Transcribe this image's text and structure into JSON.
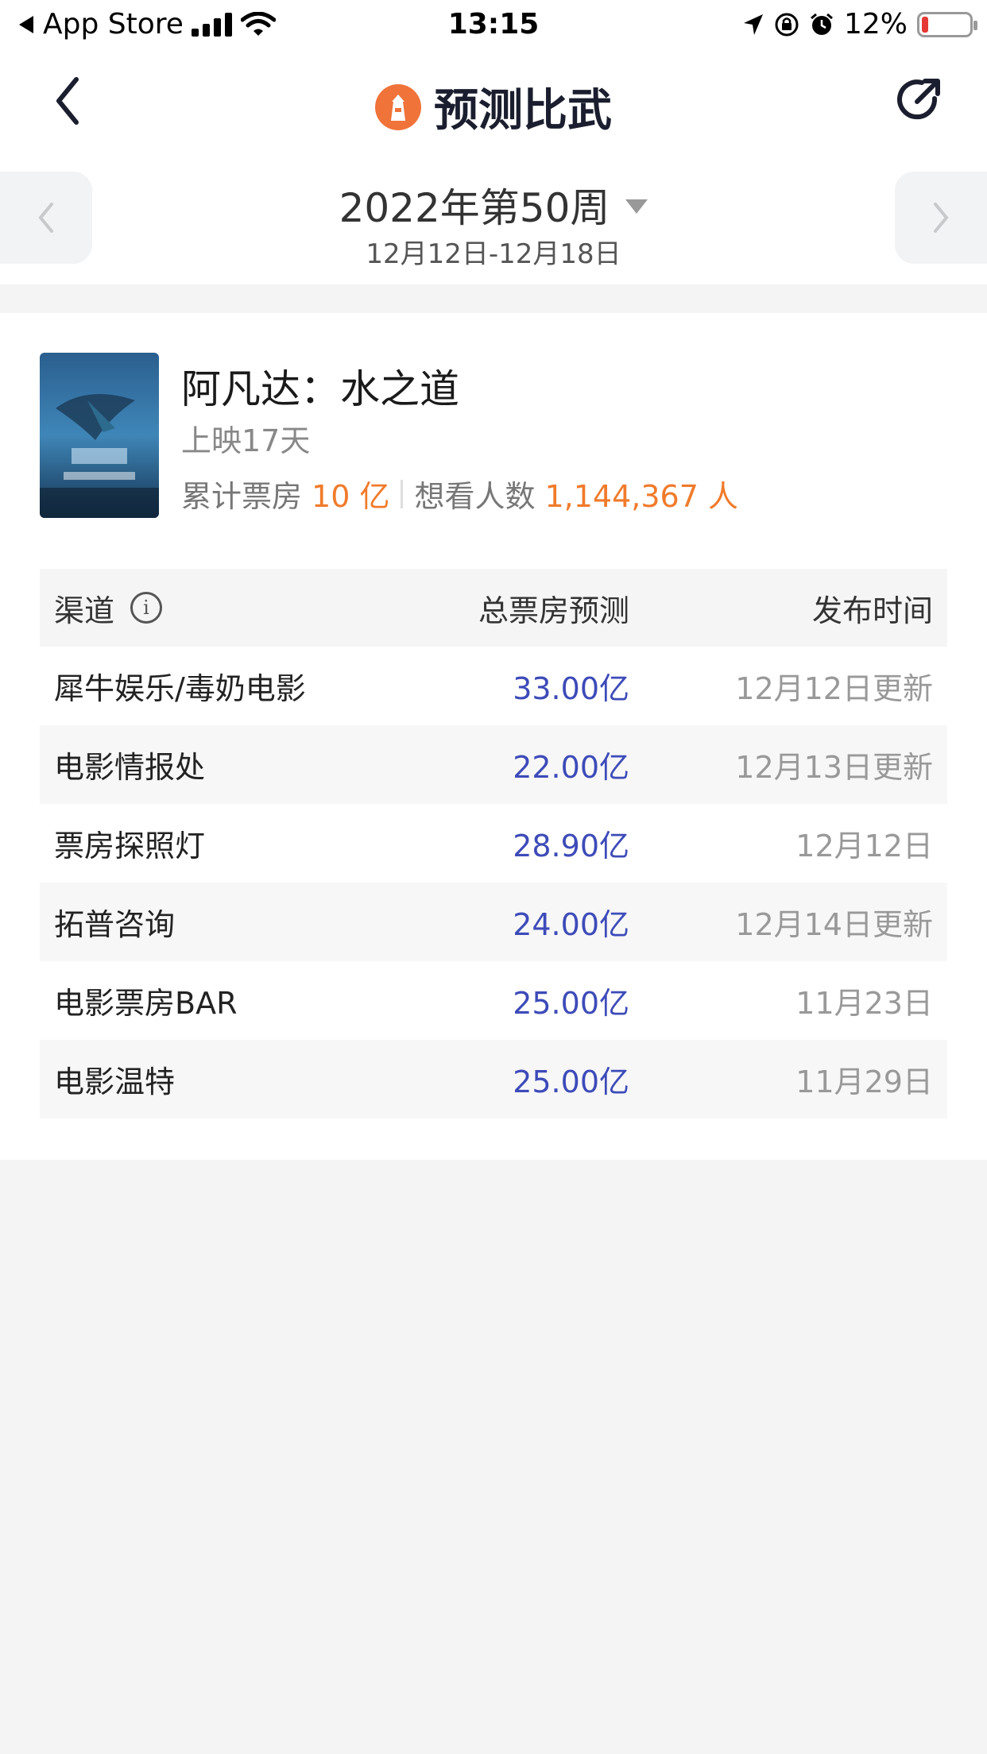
{
  "status_bar": {
    "back_app": "App Store",
    "time": "13:15",
    "battery": "12%"
  },
  "nav": {
    "title": "预测比武"
  },
  "week": {
    "title": "2022年第50周",
    "range": "12月12日-12月18日"
  },
  "movie": {
    "title": "阿凡达：水之道",
    "days": "上映17天",
    "box_label": "累计票房",
    "box_value": "10 亿",
    "want_label": "想看人数",
    "want_value": "1,144,367 人"
  },
  "table": {
    "headers": [
      "渠道",
      "总票房预测",
      "发布时间"
    ],
    "rows": [
      {
        "channel": "犀牛娱乐/毒奶电影",
        "value": "33.00亿",
        "time": "12月12日更新"
      },
      {
        "channel": "电影情报处",
        "value": "22.00亿",
        "time": "12月13日更新"
      },
      {
        "channel": "票房探照灯",
        "value": "28.90亿",
        "time": "12月12日"
      },
      {
        "channel": "拓普咨询",
        "value": "24.00亿",
        "time": "12月14日更新"
      },
      {
        "channel": "电影票房BAR",
        "value": "25.00亿",
        "time": "11月23日"
      },
      {
        "channel": "电影温特",
        "value": "25.00亿",
        "time": "11月29日"
      }
    ]
  },
  "colors": {
    "accent_orange": "#f07b2b",
    "value_blue": "#3d4bb8",
    "battery_red": "#e53935"
  },
  "icons": [
    "back-arrow-icon",
    "signal-icon",
    "wifi-icon",
    "location-icon",
    "rotation-lock-icon",
    "alarm-icon",
    "battery-icon",
    "lighthouse-logo-icon",
    "share-icon",
    "chevron-left-icon",
    "chevron-right-icon",
    "caret-down-icon",
    "info-icon"
  ]
}
